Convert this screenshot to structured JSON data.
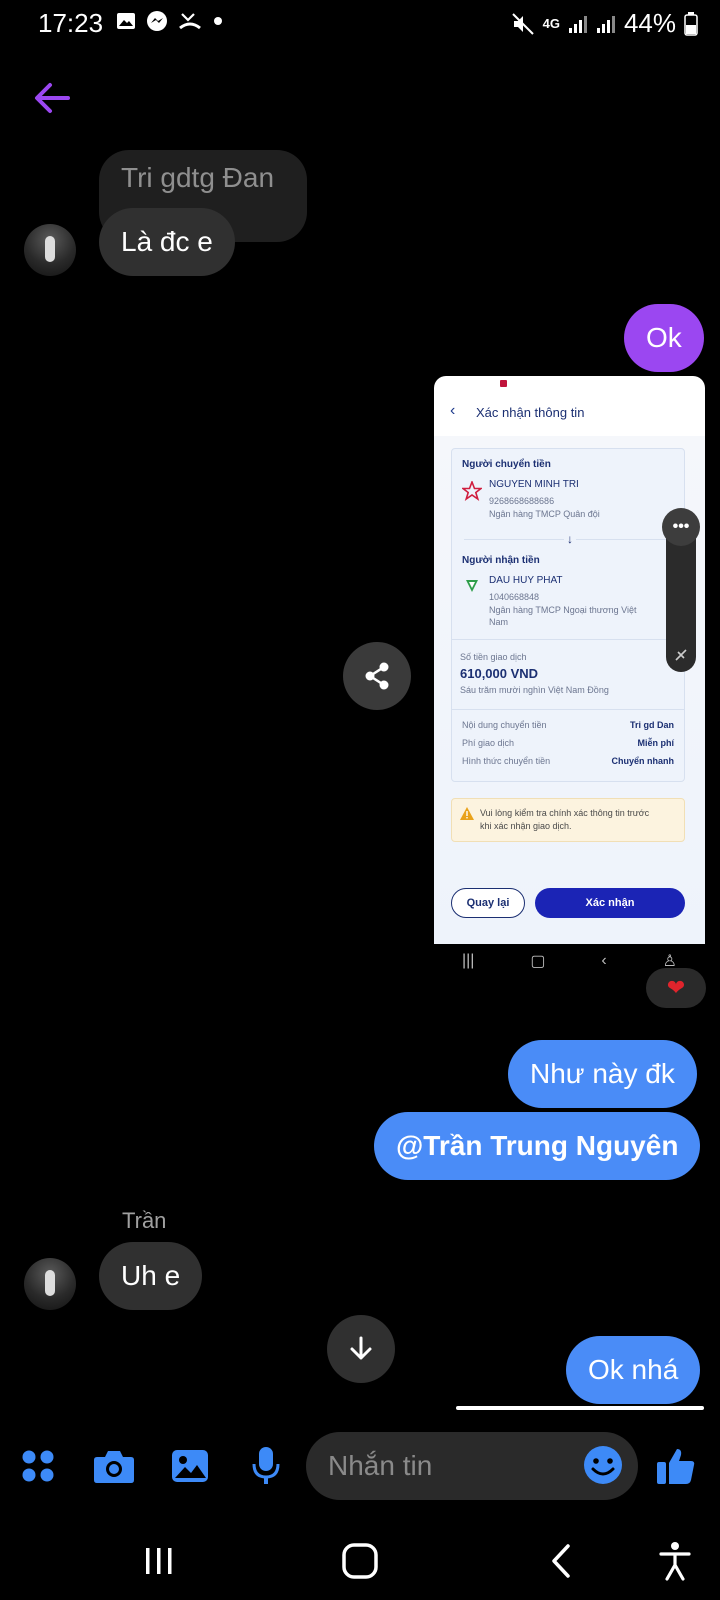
{
  "status_bar": {
    "time": "17:23",
    "network": "4G",
    "battery": "44%",
    "left_icons": [
      "gallery-icon",
      "messenger-icon",
      "missed-call-icon",
      "dot-icon"
    ],
    "right_icons": [
      "mute-icon",
      "network-4g-icon",
      "signal-icon",
      "signal-icon",
      "battery-icon"
    ]
  },
  "header": {
    "back_icon": "arrow-left-icon",
    "accent": "#9b47f1"
  },
  "messages": {
    "reply_quote": "Tri gdtg Đan",
    "incoming_1": "Là đc e",
    "outgoing_ok": "Ok",
    "outgoing_nhu_nay": "Như này đk",
    "outgoing_mention": "@Trần Trung Nguyên",
    "sender_name": "Trần",
    "incoming_2": "Uh e",
    "outgoing_last": "Ok nhá"
  },
  "reaction": "❤",
  "attachment": {
    "title": "Xác nhận thông tin",
    "sender_label": "Người chuyển tiền",
    "sender_name": "NGUYEN MINH TRI",
    "sender_account": "9268668688686",
    "sender_bank": "Ngân hàng TMCP Quân đội",
    "receiver_label": "Người nhận tiền",
    "receiver_name": "DAU HUY PHAT",
    "receiver_account": "1040668848",
    "receiver_bank_1": "Ngân hàng TMCP Ngoại thương Việt",
    "receiver_bank_2": "Nam",
    "amount_label": "Số tiền giao dịch",
    "amount": "610,000 VND",
    "amount_words": "Sáu trăm mười nghìn Việt Nam Đồng",
    "content_label": "Nội dung chuyển tiền",
    "content_value": "Tri gd Dan",
    "fee_label": "Phí giao dịch",
    "fee_value": "Miễn phí",
    "method_label": "Hình thức chuyển tiền",
    "method_value": "Chuyển nhanh",
    "warning_1": "Vui lòng kiểm tra chính xác thông tin trước",
    "warning_2": "khi xác nhận giao dịch.",
    "btn_back": "Quay lại",
    "btn_confirm": "Xác nhận"
  },
  "composer": {
    "placeholder": "Nhắn tin",
    "accent": "#3d8af7",
    "icons": [
      "apps-icon",
      "camera-icon",
      "image-icon",
      "mic-icon",
      "emoji-icon",
      "like-icon"
    ]
  },
  "nav": {
    "icons": [
      "recents-icon",
      "home-icon",
      "back-icon",
      "accessibility-icon"
    ]
  }
}
